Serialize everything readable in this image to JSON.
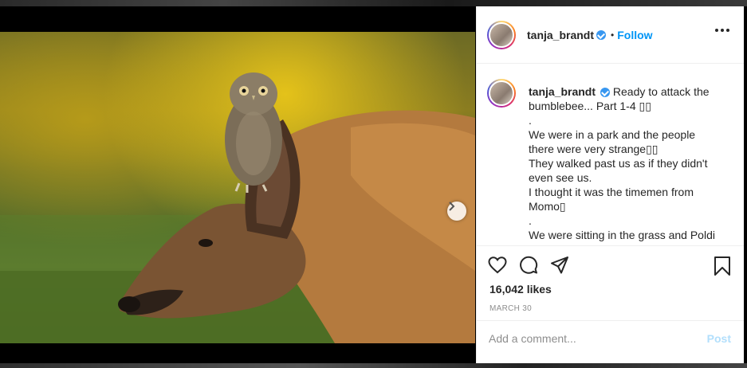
{
  "post": {
    "username": "tanja_brandt",
    "follow_label": "Follow",
    "bullet": "•",
    "caption_lines": [
      "Ready to attack the",
      "bumblebee... Part 1-4 ▯▯",
      ".",
      "We were in a park and the people",
      "there were very strange▯▯",
      "They walked past us as if they didn't",
      "even see us.",
      "I thought it was the timemen from",
      "Momo▯",
      ".",
      "We were sitting in the grass and Poldi"
    ],
    "likes": "16,042 likes",
    "date": "MARCH 30",
    "comment_placeholder": "Add a comment...",
    "post_label": "Post"
  },
  "carousel": {
    "total": 4,
    "active_index": 0
  },
  "icons": {
    "more": "more-options-icon",
    "like": "heart-icon",
    "comment": "comment-icon",
    "share": "share-icon",
    "save": "bookmark-icon",
    "next": "chevron-right-icon"
  },
  "colors": {
    "link_blue": "#0095f6",
    "verified_blue": "#3897f0",
    "post_disabled": "#b2dffc"
  }
}
